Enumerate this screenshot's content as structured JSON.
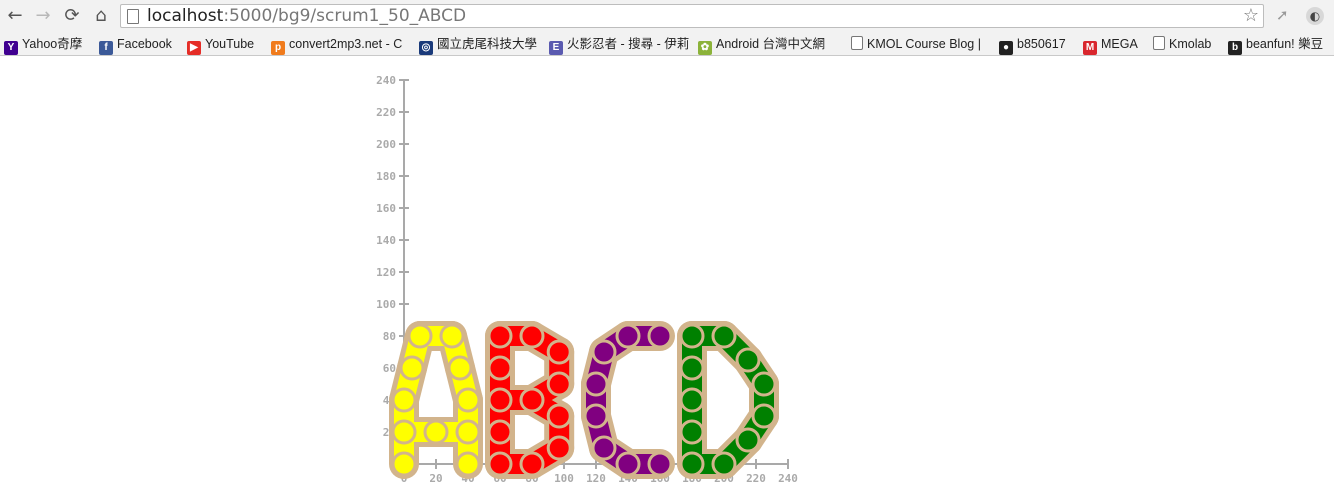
{
  "browser": {
    "url_host": "localhost",
    "url_path": ":5000/bg9/scrum1_50_ABCD",
    "nav": {
      "back": "←",
      "forward": "→",
      "reload": "⟳",
      "home": "⌂"
    },
    "star_icon": "☆"
  },
  "bookmarks": [
    {
      "label": "Yahoo奇摩",
      "icon": "Y",
      "color": "#400090"
    },
    {
      "label": "Facebook",
      "icon": "f",
      "color": "#3b5998"
    },
    {
      "label": "YouTube",
      "icon": "▶",
      "color": "#e52d27"
    },
    {
      "label": "convert2mp3.net - C",
      "icon": "p",
      "color": "#f07b1c"
    },
    {
      "label": "國立虎尾科技大學",
      "icon": "◎",
      "color": "#1a3a7a"
    },
    {
      "label": "火影忍者 - 搜尋 - 伊莉",
      "icon": "E",
      "color": "#5a5ab0"
    },
    {
      "label": "Android 台灣中文網",
      "icon": "✿",
      "color": "#8cb33a"
    },
    {
      "label": "KMOL Course Blog |",
      "icon": "",
      "color": "#ffffff"
    },
    {
      "label": "b850617",
      "icon": "●",
      "color": "#222222"
    },
    {
      "label": "MEGA",
      "icon": "M",
      "color": "#d9272e"
    },
    {
      "label": "Kmolab",
      "icon": "",
      "color": "#ffffff"
    },
    {
      "label": "beanfun! 樂豆",
      "icon": "b",
      "color": "#222222"
    }
  ],
  "chart_data": {
    "type": "scatter",
    "title": "",
    "xlabel": "",
    "ylabel": "",
    "xlim": [
      0,
      240
    ],
    "ylim": [
      0,
      240
    ],
    "x_ticks": [
      "0",
      "20",
      "40",
      "60",
      "80",
      "100",
      "120",
      "140",
      "160",
      "180",
      "200",
      "220",
      "240"
    ],
    "y_ticks": [
      "0",
      "20",
      "40",
      "60",
      "80",
      "100",
      "120",
      "140",
      "160",
      "180",
      "200",
      "220",
      "240"
    ],
    "grid": false,
    "link_color": "#d2b48c",
    "series": [
      {
        "letter": "A",
        "color": "#ffff00",
        "points": [
          [
            0,
            0
          ],
          [
            0,
            20
          ],
          [
            0,
            40
          ],
          [
            5,
            60
          ],
          [
            10,
            80
          ],
          [
            30,
            80
          ],
          [
            35,
            60
          ],
          [
            40,
            40
          ],
          [
            40,
            20
          ],
          [
            40,
            0
          ],
          [
            20,
            20
          ]
        ],
        "links": [
          [
            0,
            1
          ],
          [
            1,
            2
          ],
          [
            2,
            3
          ],
          [
            3,
            4
          ],
          [
            4,
            5
          ],
          [
            5,
            6
          ],
          [
            6,
            7
          ],
          [
            7,
            8
          ],
          [
            8,
            9
          ],
          [
            1,
            10
          ],
          [
            10,
            8
          ]
        ]
      },
      {
        "letter": "B",
        "color": "#ff0000",
        "points": [
          [
            60,
            0
          ],
          [
            60,
            20
          ],
          [
            60,
            40
          ],
          [
            60,
            60
          ],
          [
            60,
            80
          ],
          [
            80,
            80
          ],
          [
            97,
            70
          ],
          [
            97,
            50
          ],
          [
            80,
            40
          ],
          [
            97,
            30
          ],
          [
            97,
            10
          ],
          [
            80,
            0
          ]
        ],
        "links": [
          [
            0,
            1
          ],
          [
            1,
            2
          ],
          [
            2,
            3
          ],
          [
            3,
            4
          ],
          [
            4,
            5
          ],
          [
            5,
            6
          ],
          [
            6,
            7
          ],
          [
            7,
            8
          ],
          [
            8,
            2
          ],
          [
            8,
            9
          ],
          [
            9,
            10
          ],
          [
            10,
            11
          ],
          [
            11,
            0
          ]
        ]
      },
      {
        "letter": "C",
        "color": "#800080",
        "points": [
          [
            160,
            80
          ],
          [
            140,
            80
          ],
          [
            125,
            70
          ],
          [
            120,
            50
          ],
          [
            120,
            30
          ],
          [
            125,
            10
          ],
          [
            140,
            0
          ],
          [
            160,
            0
          ]
        ],
        "links": [
          [
            0,
            1
          ],
          [
            1,
            2
          ],
          [
            2,
            3
          ],
          [
            3,
            4
          ],
          [
            4,
            5
          ],
          [
            5,
            6
          ],
          [
            6,
            7
          ]
        ]
      },
      {
        "letter": "D",
        "color": "#008000",
        "points": [
          [
            180,
            0
          ],
          [
            180,
            20
          ],
          [
            180,
            40
          ],
          [
            180,
            60
          ],
          [
            180,
            80
          ],
          [
            200,
            80
          ],
          [
            215,
            65
          ],
          [
            225,
            50
          ],
          [
            225,
            30
          ],
          [
            215,
            15
          ],
          [
            200,
            0
          ]
        ],
        "links": [
          [
            0,
            1
          ],
          [
            1,
            2
          ],
          [
            2,
            3
          ],
          [
            3,
            4
          ],
          [
            4,
            5
          ],
          [
            5,
            6
          ],
          [
            6,
            7
          ],
          [
            7,
            8
          ],
          [
            8,
            9
          ],
          [
            9,
            10
          ],
          [
            10,
            0
          ]
        ]
      }
    ]
  }
}
